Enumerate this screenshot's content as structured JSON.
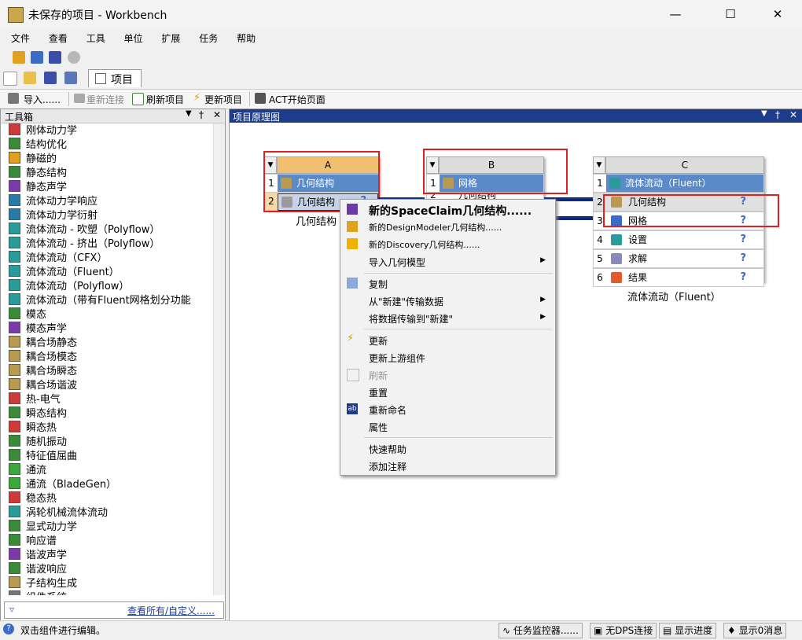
{
  "window": {
    "title": "未保存的项目 - Workbench"
  },
  "menu": [
    "文件",
    "查看",
    "工具",
    "单位",
    "扩展",
    "任务",
    "帮助"
  ],
  "tabs": {
    "project": "项目"
  },
  "toolbar": {
    "import": "导入......",
    "reconnect": "重新连接",
    "refresh_project": "刷新项目",
    "update_project": "更新项目",
    "act_home": "ACT开始页面"
  },
  "toolbox": {
    "title": "工具箱",
    "items": [
      "刚体动力学",
      "结构优化",
      "静磁的",
      "静态结构",
      "静态声学",
      "流体动力学响应",
      "流体动力学衍射",
      "流体流动 - 吹塑（Polyflow）",
      "流体流动 - 挤出（Polyflow）",
      "流体流动（CFX）",
      "流体流动（Fluent）",
      "流体流动（Polyflow）",
      "流体流动（带有Fluent网格划分功能",
      "模态",
      "模态声学",
      "耦合场静态",
      "耦合场模态",
      "耦合场瞬态",
      "耦合场谐波",
      "热-电气",
      "瞬态结构",
      "瞬态热",
      "随机振动",
      "特征值屈曲",
      "通流",
      "通流（BladeGen）",
      "稳态热",
      "涡轮机械流体流动",
      "显式动力学",
      "响应谱",
      "谐波声学",
      "谐波响应",
      "子结构生成",
      "组件系统"
    ],
    "view_all": "查看所有/自定义......"
  },
  "schematic": {
    "title": "项目原理图",
    "systems": [
      {
        "col": "A",
        "rows": [
          {
            "n": "1",
            "label": "几何结构"
          },
          {
            "n": "2",
            "label": "几何结构"
          }
        ],
        "caption": "几何结构"
      },
      {
        "col": "B",
        "rows": [
          {
            "n": "1",
            "label": "网格"
          },
          {
            "n": "2",
            "label": "几何结构"
          }
        ]
      },
      {
        "col": "C",
        "rows": [
          {
            "n": "1",
            "label": "流体流动（Fluent）"
          },
          {
            "n": "2",
            "label": "几何结构"
          },
          {
            "n": "3",
            "label": "网格"
          },
          {
            "n": "4",
            "label": "设置"
          },
          {
            "n": "5",
            "label": "求解"
          },
          {
            "n": "6",
            "label": "结果"
          }
        ],
        "caption": "流体流动（Fluent）"
      }
    ]
  },
  "context_menu": {
    "new_spaceclaim": "新的SpaceClaim几何结构......",
    "new_designmodeler": "新的DesignModeler几何结构......",
    "new_discovery": "新的Discovery几何结构......",
    "import_geometry": "导入几何模型",
    "copy": "复制",
    "transfer_from_new": "从\"新建\"传输数据",
    "transfer_to_new": "将数据传输到\"新建\"",
    "update": "更新",
    "update_upstream": "更新上游组件",
    "refresh": "刷新",
    "reset": "重置",
    "rename": "重新命名",
    "properties": "属性",
    "quick_help": "快速帮助",
    "add_note": "添加注释"
  },
  "statusbar": {
    "message": "双击组件进行编辑。",
    "task_monitor": "任务监控器......",
    "no_dps": "无DPS连接",
    "show_progress": "显示进度",
    "show_messages": "显示0消息"
  }
}
